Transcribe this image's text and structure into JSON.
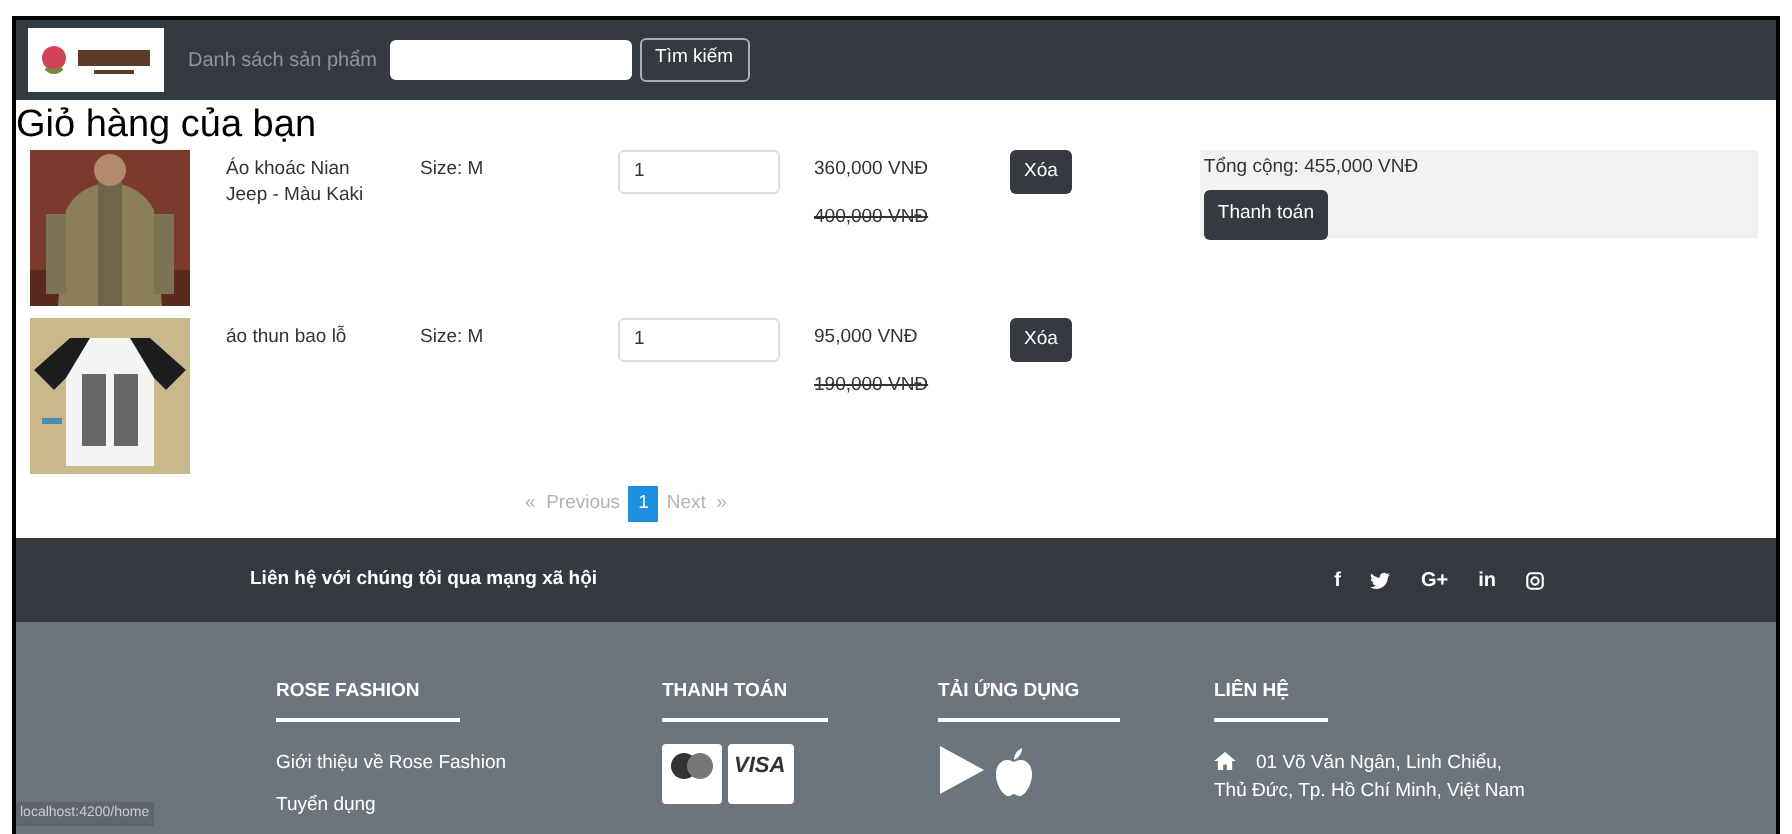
{
  "header": {
    "nav_label": "Danh sách sản phẩm",
    "search_button": "Tìm kiếm"
  },
  "page_title": "Giỏ hàng của bạn",
  "cart_items": [
    {
      "kind": "jacket",
      "name": "Áo khoác Nian Jeep - Màu Kaki",
      "size": "Size: M",
      "quantity": "1",
      "price": "360,000 VNĐ",
      "old_price": "400,000 VNĐ",
      "remove_button": "Xóa"
    },
    {
      "kind": "tshirt",
      "name": "áo thun bao lỗ",
      "size": "Size: M",
      "quantity": "1",
      "price": "95,000 VNĐ",
      "old_price": "190,000 VNĐ",
      "remove_button": "Xóa"
    }
  ],
  "summary": {
    "total": "Tổng cộng: 455,000 VNĐ",
    "checkout_button": "Thanh toán"
  },
  "pagination": {
    "previous": "«  Previous",
    "pages": [
      {
        "label": "1",
        "selected": true
      }
    ],
    "next": "Next  »"
  },
  "social_bar": {
    "text": "Liên hệ với chúng tôi qua mạng xã hội",
    "icons": [
      {
        "kind": "text",
        "label": "f"
      },
      {
        "kind": "twitter"
      },
      {
        "kind": "text",
        "label": "G+"
      },
      {
        "kind": "text",
        "label": "in"
      },
      {
        "kind": "instagram"
      }
    ]
  },
  "footer": {
    "columns": [
      {
        "kind": "links",
        "heading": "ROSE FASHION",
        "links": [
          "Giới thiệu về Rose Fashion",
          "Tuyển dụng"
        ]
      },
      {
        "kind": "payment",
        "heading": "THANH TOÁN",
        "cards": [
          "VISA"
        ]
      },
      {
        "kind": "apps",
        "heading": "TẢI ỨNG DỤNG"
      },
      {
        "kind": "contact",
        "heading": "LIÊN HỆ",
        "address": "01 Võ Văn Ngân, Linh Chiểu, Thủ Đức, Tp. Hồ Chí Minh, Việt Nam"
      }
    ]
  },
  "status_url": "localhost:4200/home"
}
